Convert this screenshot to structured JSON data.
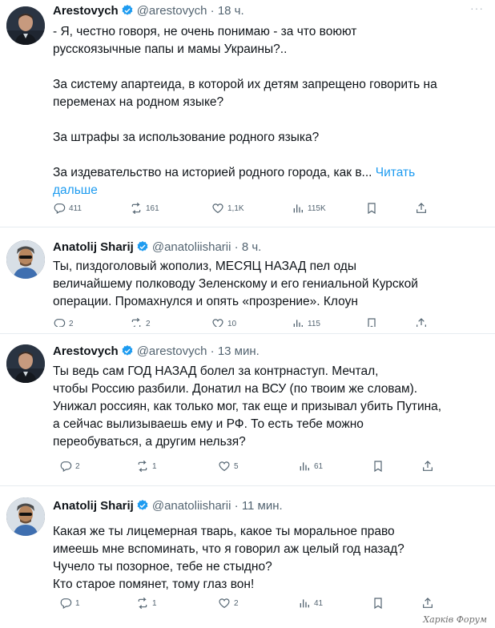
{
  "tweets": [
    {
      "name": "Arestovych",
      "handle": "@arestovych",
      "dot": "·",
      "time": "18 ч.",
      "more": "···",
      "lines": [
        "- Я, честно говоря, не очень понимаю - за что воюют",
        "русскоязычные папы и мамы Украины?..",
        "",
        "За систему апартеида, в которой их детям запрещено говорить на",
        "переменах на родном языке?",
        "",
        "За штрафы за использование родного языка?",
        "",
        "За издевательство на историей родного города, как в..."
      ],
      "read_more_1": "Читать",
      "read_more_2": "дальше",
      "replies": "411",
      "reposts": "161",
      "likes": "1,1K",
      "views": "115K"
    },
    {
      "name": "Anatolij Sharij",
      "handle": "@anatoliisharii",
      "dot": "·",
      "time": "8 ч.",
      "lines": [
        "Ты, пиздоголовый жополиз, МЕСЯЦ НАЗАД пел оды",
        "величайшему полководу Зеленскому и его гениальной Курской",
        "операции. Промахнулся и опять «прозрение». Клоун"
      ],
      "replies": "2",
      "reposts": "2",
      "likes": "10",
      "views": "115"
    },
    {
      "name": "Arestovych",
      "handle": "@arestovych",
      "dot": "·",
      "time": "13 мин.",
      "lines": [
        "Ты ведь сам ГОД НАЗАД болел за контрнаступ. Мечтал,",
        "чтобы Россию разбили. Донатил на ВСУ (по твоим же словам).",
        "Унижал россиян, как только мог, так еще и призывал убить Путина,",
        "а сейчас вылизываешь ему и РФ. То есть тебе можно",
        "переобуваться, а другим нельзя?"
      ],
      "replies": "2",
      "reposts": "1",
      "likes": "5",
      "views": "61"
    },
    {
      "name": "Anatolij Sharij",
      "handle": "@anatoliisharii",
      "dot": "·",
      "time": "11 мин.",
      "lines": [
        "Какая же ты лицемерная тварь, какое ты моральное право",
        "имеешь мне вспоминать, что я говорил аж целый год назад?",
        "Чучело ты позорное, тебе не стыдно?",
        "Кто старое помянет, тому глаз вон!"
      ],
      "replies": "1",
      "reposts": "1",
      "likes": "2",
      "views": "41"
    }
  ],
  "watermark": "Харків Форум",
  "colors": {
    "verified": "#1d9bf0",
    "link": "#1d9bf0",
    "muted": "#536471"
  },
  "icons": [
    "reply-icon",
    "repost-icon",
    "like-icon",
    "views-icon",
    "bookmark-icon",
    "share-icon"
  ]
}
